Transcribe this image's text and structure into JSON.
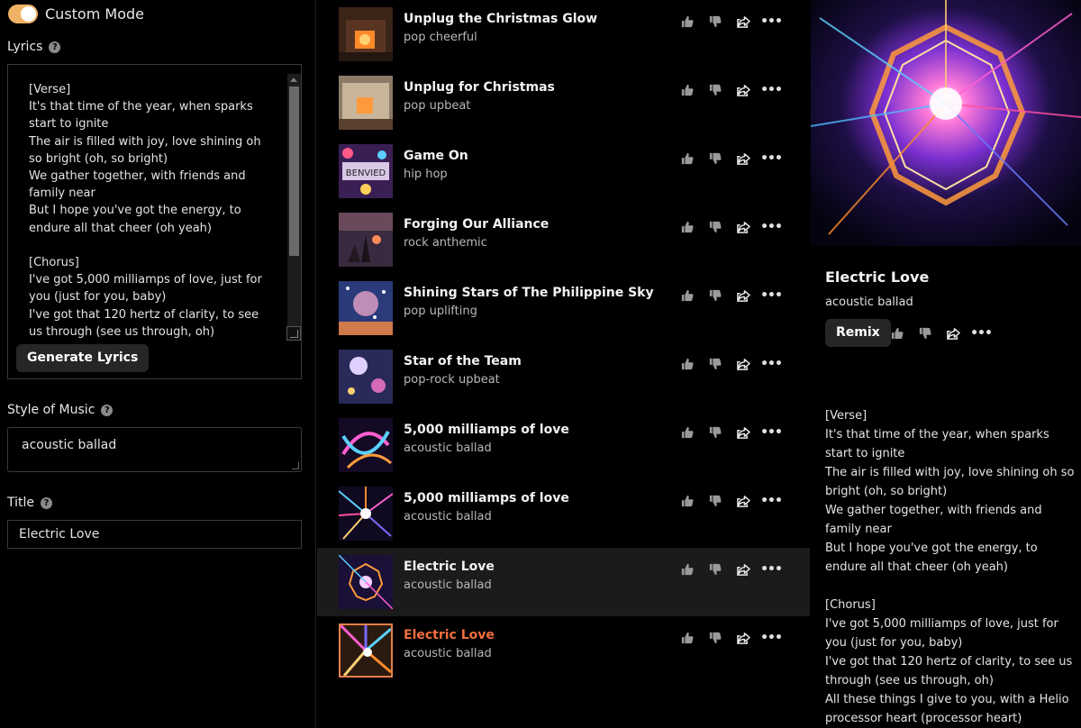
{
  "left": {
    "custom_mode_label": "Custom Mode",
    "custom_mode_on": true,
    "lyrics_label": "Lyrics",
    "lyrics_text": "[Verse]\nIt's that time of the year, when sparks start to ignite\nThe air is filled with joy, love shining oh so bright (oh, so bright)\nWe gather together, with friends and family near\nBut I hope you've got the energy, to endure all that cheer (oh yeah)\n\n[Chorus]\nI've got 5,000 milliamps of love, just for you (just for you, baby)\nI've got that 120 hertz of clarity, to see us through (see us through, oh)",
    "generate_label": "Generate Lyrics",
    "style_label": "Style of Music",
    "style_value": "acoustic ballad",
    "title_label": "Title",
    "title_value": "Electric Love",
    "help_glyph": "?"
  },
  "songs": [
    {
      "title": "Unplug the Christmas Glow",
      "style": "pop cheerful"
    },
    {
      "title": "Unplug for Christmas",
      "style": "pop upbeat"
    },
    {
      "title": "Game On",
      "style": "hip hop"
    },
    {
      "title": "Forging Our Alliance",
      "style": "rock anthemic"
    },
    {
      "title": "Shining Stars of The Philippine Sky",
      "style": "pop uplifting"
    },
    {
      "title": "Star of the Team",
      "style": "pop-rock upbeat"
    },
    {
      "title": "5,000 milliamps of love",
      "style": "acoustic ballad"
    },
    {
      "title": "5,000 milliamps of love",
      "style": "acoustic ballad"
    },
    {
      "title": "Electric Love",
      "style": "acoustic ballad"
    },
    {
      "title": "Electric Love",
      "style": "acoustic ballad"
    }
  ],
  "right": {
    "title": "Electric Love",
    "style": "acoustic ballad",
    "remix_label": "Remix",
    "lyrics": "[Verse]\nIt's that time of the year, when sparks start to ignite\nThe air is filled with joy, love shining oh so bright (oh, so bright)\nWe gather together, with friends and family near\nBut I hope you've got the energy, to endure all that cheer (oh yeah)\n\n[Chorus]\nI've got 5,000 milliamps of love, just for you (just for you, baby)\nI've got that 120 hertz of clarity, to see us through (see us through, oh)\nAll these things I give to you, with a Helio processor heart (processor heart)"
  },
  "icons": {
    "like": "thumbs-up-icon",
    "dislike": "thumbs-down-icon",
    "share": "share-icon",
    "more": "more-icon"
  },
  "colors": {
    "accent": "#f0b265",
    "active_title": "#f26e3c",
    "selected_row": "#1b1b1b"
  }
}
